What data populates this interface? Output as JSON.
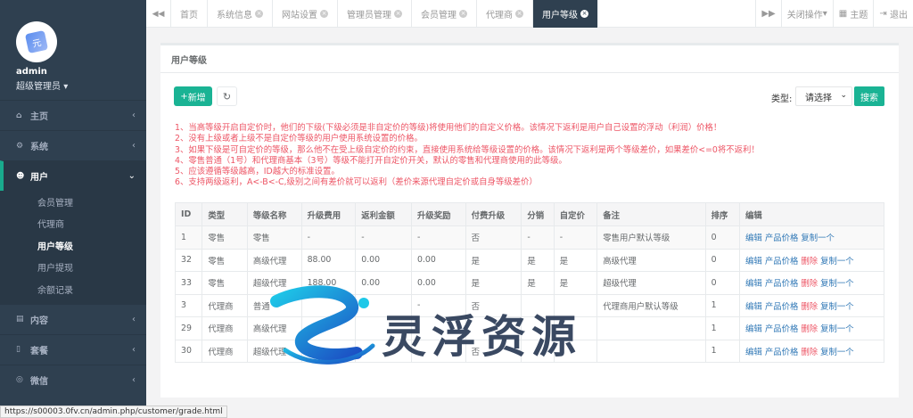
{
  "sidebar": {
    "username": "admin",
    "role": "超级管理员",
    "menu": [
      {
        "label": "主页",
        "icon": "home-icon"
      },
      {
        "label": "系统",
        "icon": "cogs-icon"
      },
      {
        "label": "用户",
        "icon": "users-icon"
      },
      {
        "label": "内容",
        "icon": "book-icon"
      },
      {
        "label": "套餐",
        "icon": "file-icon"
      },
      {
        "label": "微信",
        "icon": "wechat-icon"
      }
    ],
    "submenu": [
      "会员管理",
      "代理商",
      "用户等级",
      "用户提现",
      "余额记录"
    ]
  },
  "tabbar": {
    "tabs": [
      "首页",
      "系统信息",
      "网站设置",
      "管理员管理",
      "会员管理",
      "代理商",
      "用户等级"
    ],
    "close_ops": "关闭操作",
    "theme": "主题",
    "logout": "退出"
  },
  "panel": {
    "title": "用户等级",
    "add_label": "新增",
    "type_label": "类型:",
    "type_selected": "请选择",
    "search_label": "搜索"
  },
  "notes": [
    "1、当高等级开启自定价时，他们的下级(下级必须是非自定价的等级)将使用他们的自定义价格。该情况下返利是用户自己设置的浮动（利润）价格！",
    "2、没有上级或者上级不是自定价等级的用户使用系统设置的价格。",
    "3、如果下级是可自定价的等级，那么他不在受上级自定价的约束，直接使用系统给等级设置的价格。该情况下返利是两个等级差价，如果差价<=0将不返利！",
    "4、零售普通（1号）和代理商基本（3号）等级不能打开自定价开关，默认的零售和代理商使用的此等级。",
    "5、应该遵循等级越高，ID越大的标准设置。",
    "6、支持两级返利，A<-B<-C,级别之间有差价就可以返利（差价来源代理自定价或自身等级差价）"
  ],
  "table": {
    "headers": [
      "ID",
      "类型",
      "等级名称",
      "升级费用",
      "返利金额",
      "升级奖励",
      "付费升级",
      "分销",
      "自定价",
      "备注",
      "排序",
      "编辑"
    ],
    "rows": [
      [
        "1",
        "零售",
        "零售",
        "-",
        "-",
        "-",
        "否",
        "-",
        "-",
        "零售用户默认等级",
        "0"
      ],
      [
        "32",
        "零售",
        "高级代理",
        "88.00",
        "0.00",
        "0.00",
        "是",
        "是",
        "是",
        "高级代理",
        "0"
      ],
      [
        "33",
        "零售",
        "超级代理",
        "188.00",
        "0.00",
        "0.00",
        "是",
        "是",
        "是",
        "超级代理",
        "0"
      ],
      [
        "3",
        "代理商",
        "普通",
        "",
        "-",
        "-",
        "否",
        "",
        "",
        "代理商用户默认等级",
        "1"
      ],
      [
        "29",
        "代理商",
        "高级代理",
        "",
        "",
        "",
        "",
        "",
        "",
        "",
        "1"
      ],
      [
        "30",
        "代理商",
        "超级代理",
        "",
        "",
        "",
        "否",
        "",
        "",
        "",
        "1"
      ]
    ],
    "op_edit": "编辑",
    "op_price": "产品价格",
    "op_delete": "删除",
    "op_copy": "复制一个"
  },
  "watermark": "灵浮资源",
  "status_url": "https://s00003.0fv.cn/admin.php/customer/grade.html"
}
